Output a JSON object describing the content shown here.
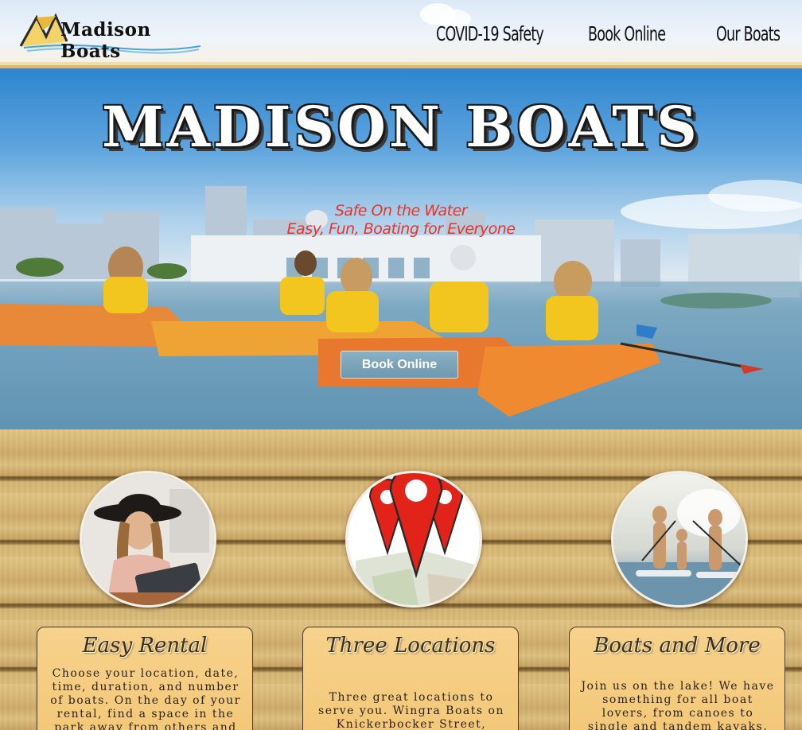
{
  "header": {
    "logo_text": "Madison Boats",
    "nav": [
      "COVID-19 Safety",
      "Book Online",
      "Our Boats"
    ]
  },
  "hero": {
    "title": "MADISON BOATS",
    "tagline_1": "Safe On the Water",
    "tagline_2": "Easy, Fun, Boating for Everyone",
    "button": "Book Online"
  },
  "features": [
    {
      "title": "Easy Rental",
      "text": "Choose your location, date, time, duration, and number of boats. On the day of your rental, find a space in the park away from others and"
    },
    {
      "title": "Three Locations",
      "text": "Three great locations to serve you. Wingra Boats on Knickerbocker Street,"
    },
    {
      "title": "Boats and More",
      "text": "Join us on the lake! We have something for all boat lovers, from canoes to single and tandem kayaks. Stand up"
    }
  ],
  "colors": {
    "tagline": "#e7352c",
    "card": "#f5cc80",
    "wood": "#d9b877",
    "button": "#7ea6bb"
  },
  "icons": [
    "location-pin-icon"
  ]
}
